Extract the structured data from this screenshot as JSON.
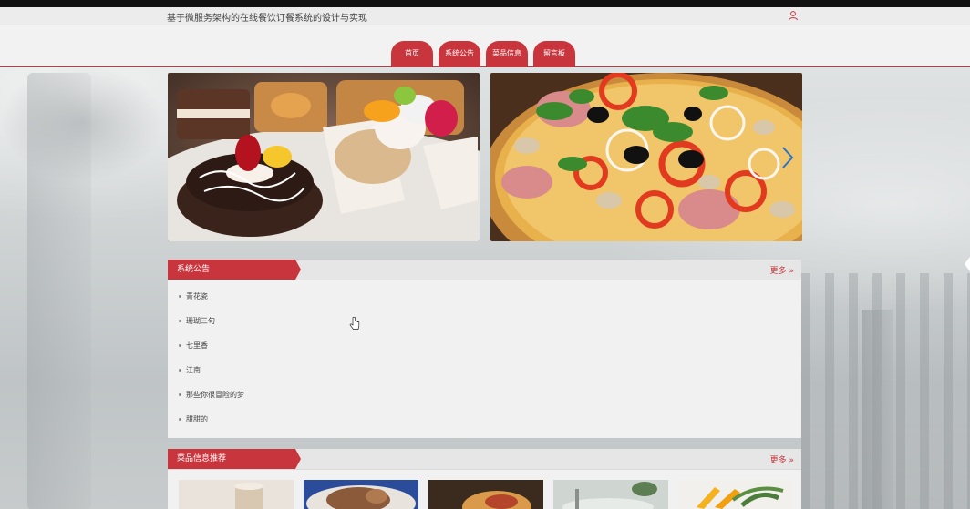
{
  "header": {
    "site_title": "基于微服务架构的在线餐饮订餐系统的设计与实现",
    "user_icon": "user-icon"
  },
  "nav": {
    "tabs": [
      {
        "label": "首页"
      },
      {
        "label": "系统公告"
      },
      {
        "label": "菜品信息"
      },
      {
        "label": "留言板"
      }
    ],
    "accent_color": "#c9353c"
  },
  "banners": [
    {
      "subject": "pastries-donut"
    },
    {
      "subject": "pizza"
    }
  ],
  "notices": {
    "title": "系统公告",
    "more_label": "更多",
    "items": [
      {
        "label": "青花瓷"
      },
      {
        "label": "珊瑚三句"
      },
      {
        "label": "七里香"
      },
      {
        "label": "江南"
      },
      {
        "label": "那些你很冒险的梦"
      },
      {
        "label": "甜甜的"
      }
    ]
  },
  "recommend": {
    "title": "菜品信息推荐",
    "more_label": "更多",
    "thumb_count": 5
  }
}
